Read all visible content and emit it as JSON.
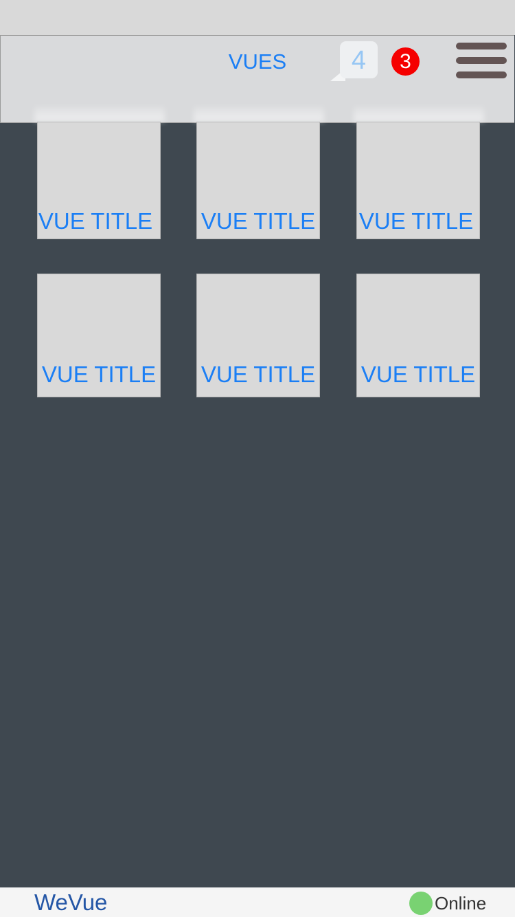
{
  "header": {
    "title": "VUES",
    "chat_count": "4",
    "notification_count": "3"
  },
  "tiles": [
    {
      "title": "VUE TITLE"
    },
    {
      "title": "VUE TITLE"
    },
    {
      "title": "VUE TITLE"
    },
    {
      "title": "VUE TITLE"
    },
    {
      "title": "VUE TITLE"
    },
    {
      "title": "VUE TITLE"
    }
  ],
  "footer": {
    "brand": "WeVue",
    "status": "Online"
  },
  "colors": {
    "accent": "#1a7ef5",
    "background": "#3f4850",
    "badge": "#f50000",
    "online": "#79d272",
    "menu_icon": "#635454"
  },
  "icons": {
    "chat": "chat-bubble-icon",
    "menu": "hamburger-menu-icon",
    "status": "online-status-dot-icon"
  }
}
